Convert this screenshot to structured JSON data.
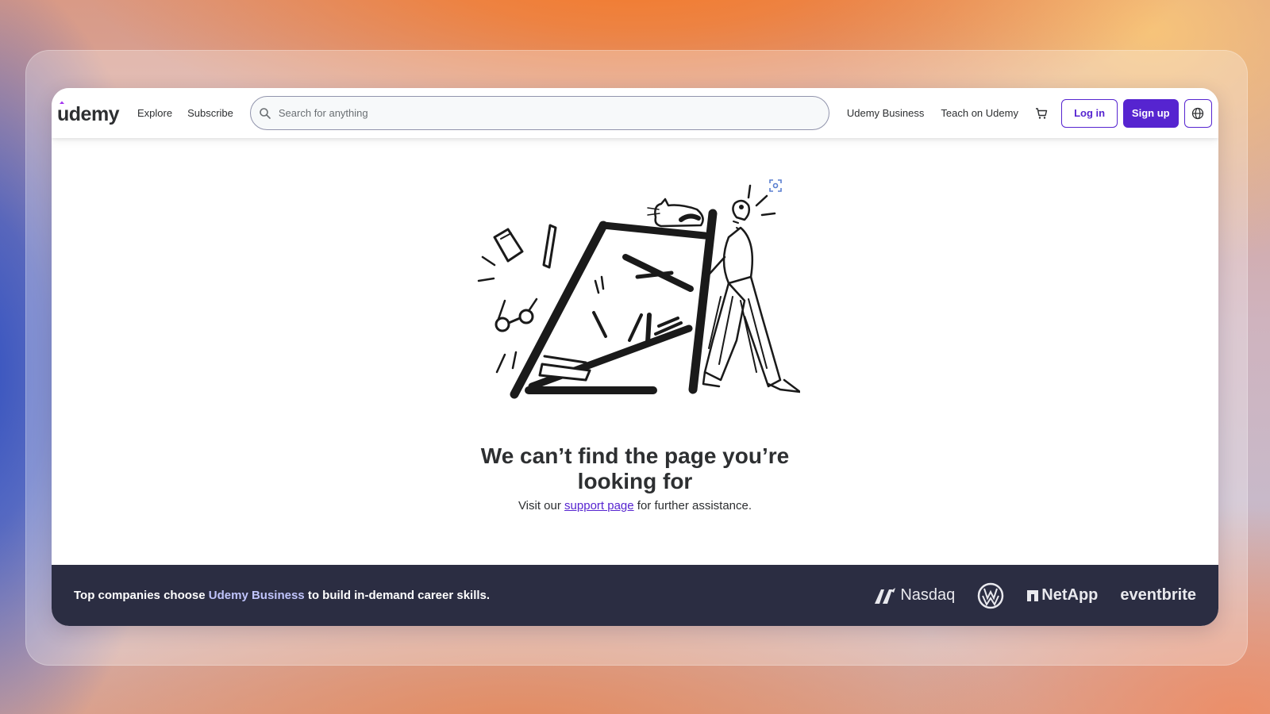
{
  "header": {
    "logo": "ûdemy",
    "nav": [
      {
        "label": "Explore"
      },
      {
        "label": "Subscribe"
      }
    ],
    "search": {
      "placeholder": "Search for anything"
    },
    "right_links": [
      {
        "label": "Udemy Business"
      },
      {
        "label": "Teach on Udemy"
      }
    ],
    "login_label": "Log in",
    "signup_label": "Sign up",
    "icons": [
      "search-icon",
      "cart-icon",
      "globe-icon"
    ]
  },
  "main": {
    "title_line1": "We can’t find the page you’re",
    "title_line2": "looking for",
    "subtitle_before": "Visit our",
    "support_link": "support page",
    "subtitle_after": "for further assistance."
  },
  "band": {
    "text_before": "Top companies choose",
    "highlight": "Udemy Business",
    "text_after": "to build in-demand career skills.",
    "logos": [
      "Nasdaq",
      "NetApp",
      "eventbrite"
    ],
    "logo_icons": [
      "nasdaq-logo",
      "volkswagen-logo",
      "netapp-logo",
      "eventbrite-logo"
    ]
  },
  "colors": {
    "accent": "#5624d0",
    "band_bg": "#2b2d42",
    "highlight": "#c0c4fc",
    "text": "#2d2f31"
  }
}
